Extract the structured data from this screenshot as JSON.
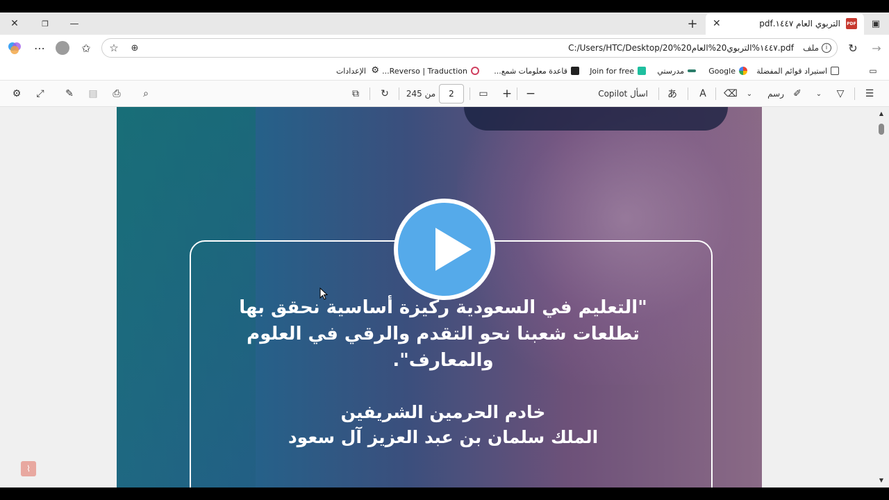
{
  "tab": {
    "title": "التربوي العام ١٤٤٧.pdf",
    "file_icon": "PDF"
  },
  "address": {
    "url": "C:/Users/HTC/Desktop/20%20١٤٤٧%التربوي20%العام.pdf",
    "file_label": "ملف"
  },
  "bookmarks": [
    {
      "label": "استيراد قوائم المفضلة",
      "icon": "import-icon"
    },
    {
      "label": "Google",
      "icon": "google-icon"
    },
    {
      "label": "مدرستي",
      "icon": "madrasati-icon"
    },
    {
      "label": "Join for free",
      "icon": "r-icon"
    },
    {
      "label": "قاعدة معلومات شمع...",
      "icon": "db-icon"
    },
    {
      "label": "Reverso | Traduction...",
      "icon": "reverso-icon"
    },
    {
      "label": "الإعدادات",
      "icon": "gear-icon"
    }
  ],
  "pdf_toolbar": {
    "page_current": "2",
    "page_of": "من 245",
    "copilot": "اسأل Copilot",
    "draw": "رسم"
  },
  "slide": {
    "quote_line1": "\"التعليم في السعودية ركيزة أساسية نحقق بها",
    "quote_line2": "تطلعات شعبنا نحو التقدم والرقي في العلوم",
    "quote_line3": "والمعارف\".",
    "attrib_line1": "خادم الحرمين الشريفين",
    "attrib_line2": "الملك سلمان بن عبد العزيز آل سعود"
  },
  "colors": {
    "play_button": "#55aaea",
    "acrobat": "#e8a8a0"
  }
}
